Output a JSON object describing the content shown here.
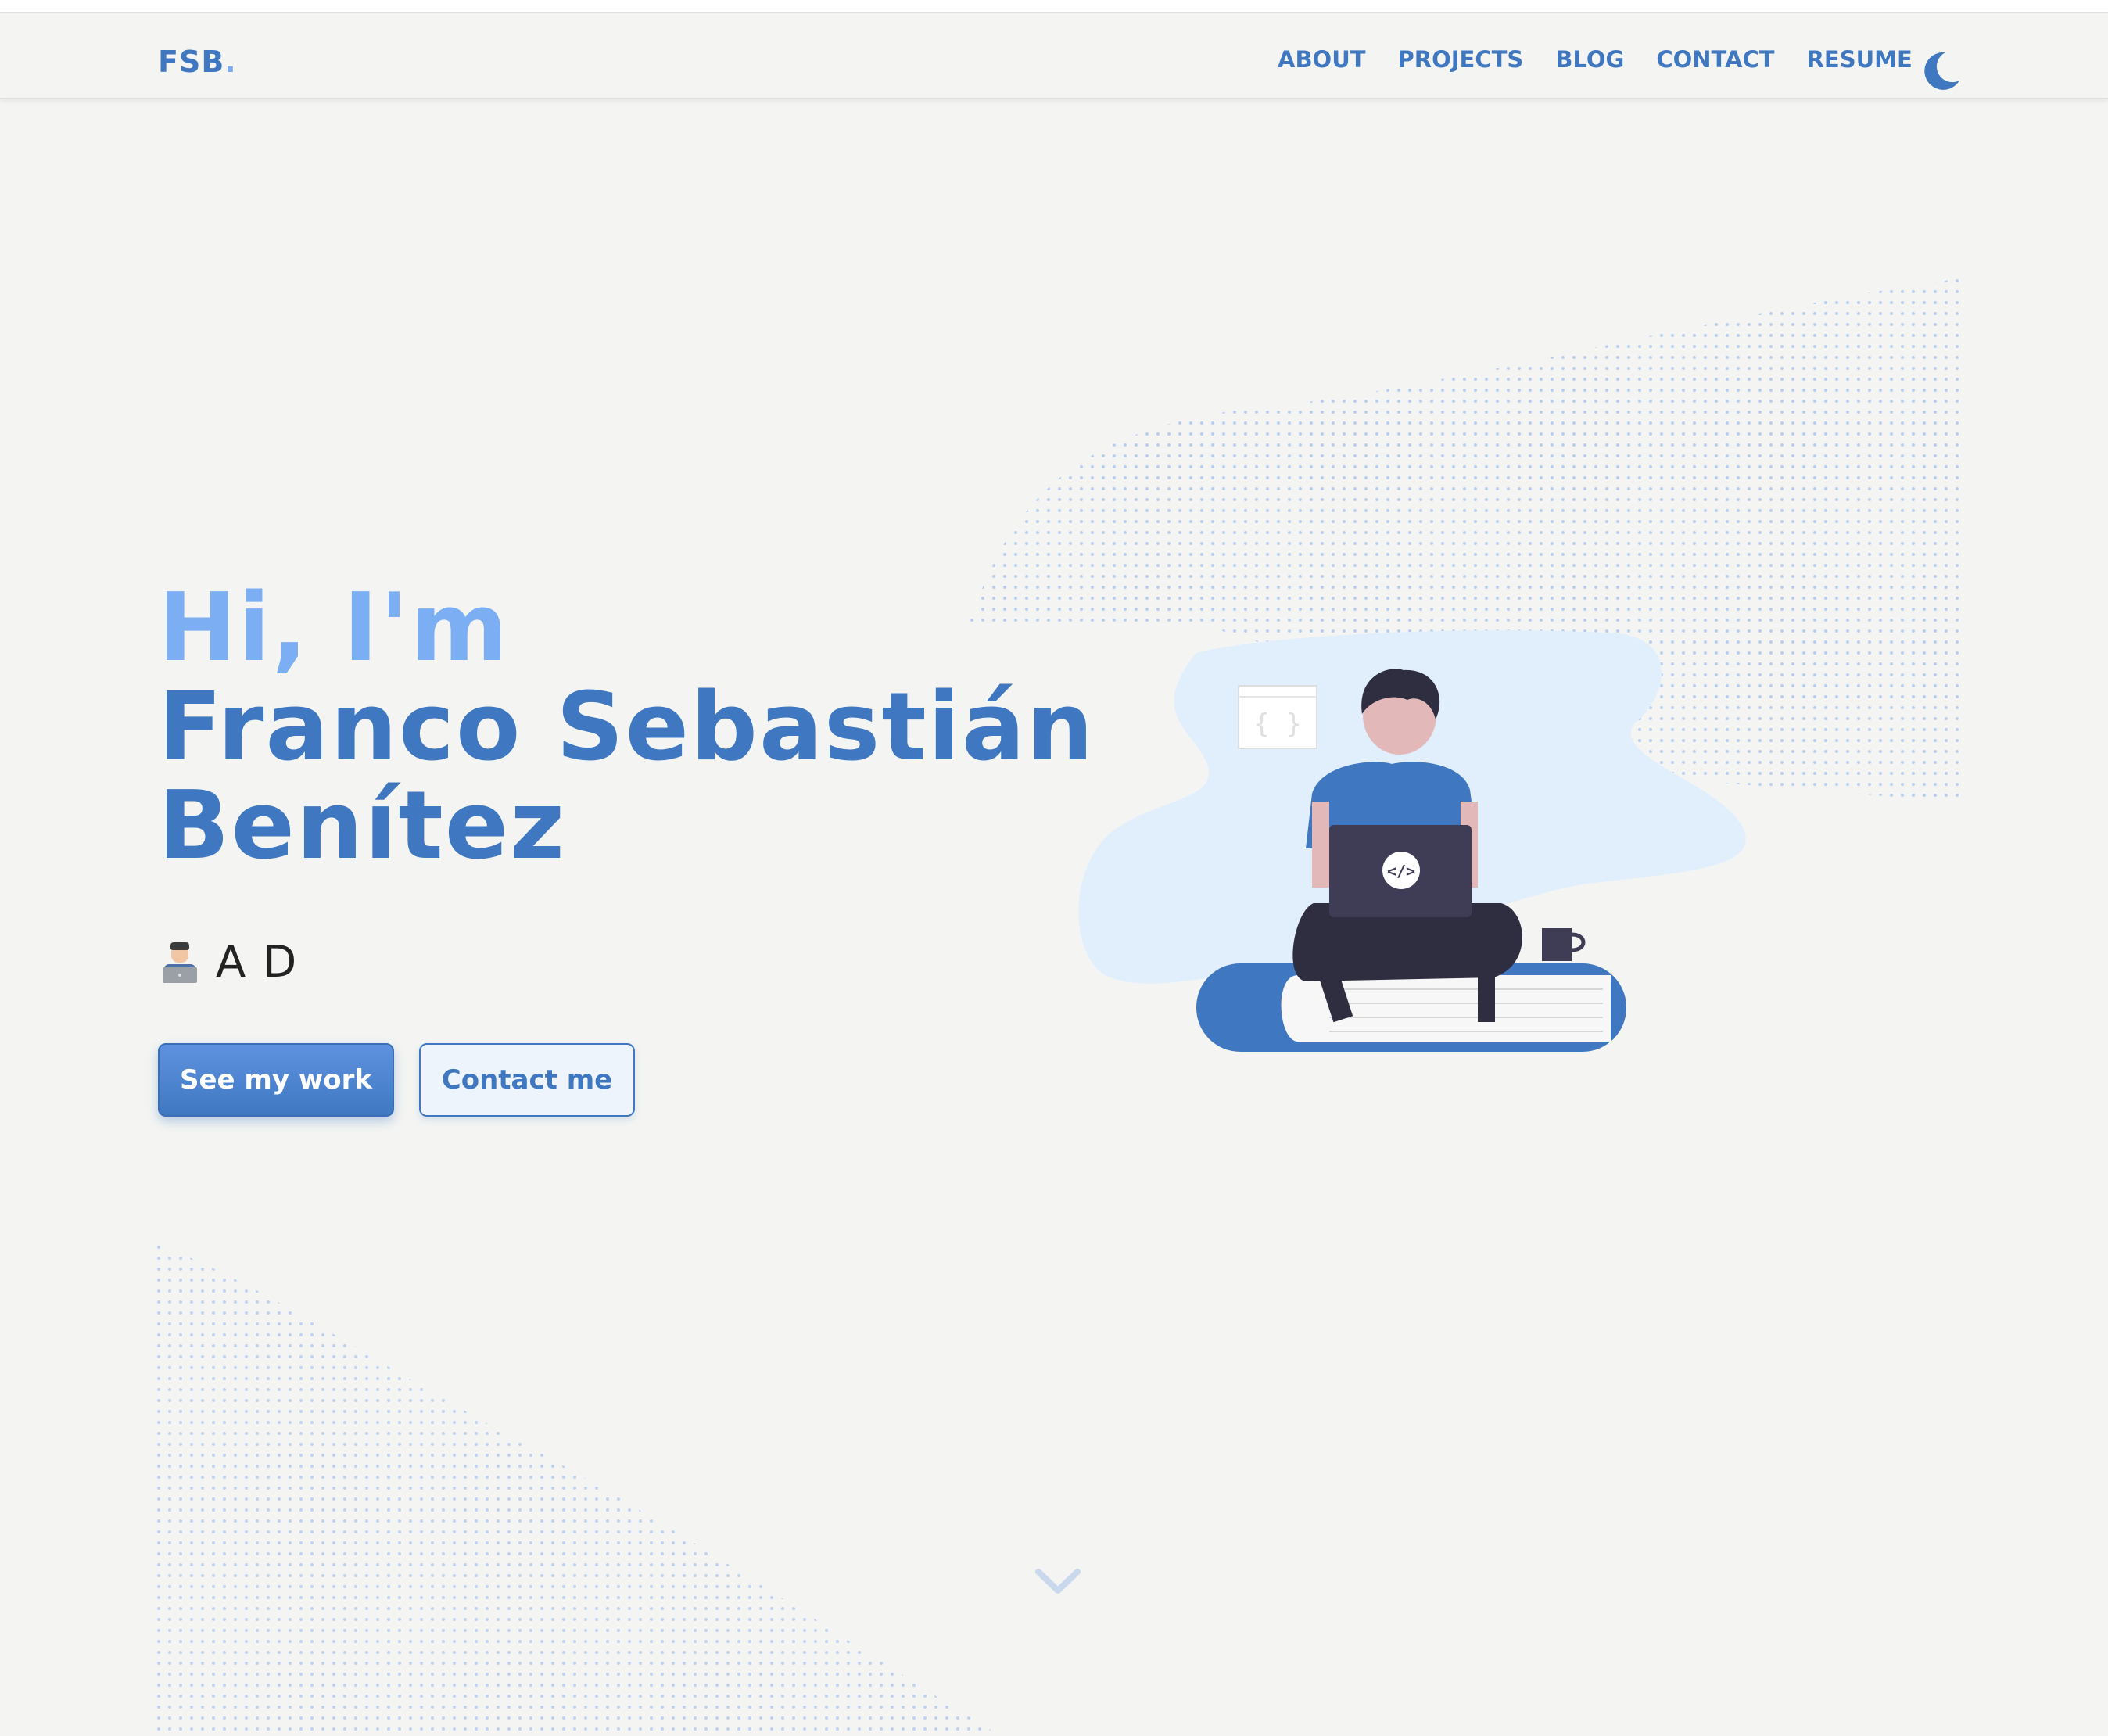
{
  "header": {
    "logo": "FSB",
    "logo_dot": ".",
    "nav": [
      "ABOUT",
      "PROJECTS",
      "BLOG",
      "CONTACT",
      "RESUME"
    ],
    "theme_toggle_icon": "moon-icon"
  },
  "hero": {
    "greeting": "Hi, I'm",
    "name_line1": "Franco Sebastián",
    "name_line2": "Benítez",
    "subtitle_icon": "technologist-emoji-icon",
    "subtitle": "A D",
    "primary_button": "See my work",
    "secondary_button": "Contact me",
    "laptop_icon_text": "</>",
    "card_icon_text": "{ }"
  },
  "scroll_icon": "chevron-down-icon",
  "colors": {
    "background": "#f4f5f3",
    "primary": "#3f78c1",
    "light_accent": "#7baef3",
    "blob": "#e1eefc",
    "dark": "#3f3d56"
  }
}
